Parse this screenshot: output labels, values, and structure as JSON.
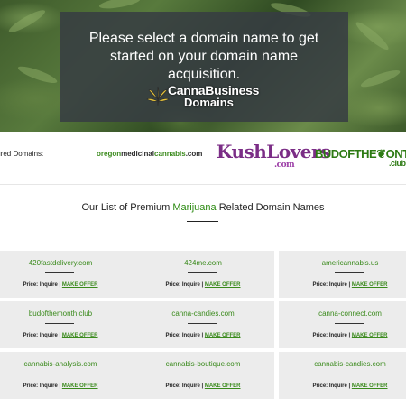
{
  "hero": {
    "heading": "Please select a domain name to get started on your domain name acquisition.",
    "logo": {
      "line1": "CannaBusiness",
      "line2": "Domains"
    }
  },
  "featured": {
    "label": "tured Domains:",
    "logos": [
      {
        "parts": [
          "oregon",
          "medicinal",
          "cannabis",
          ".com"
        ]
      },
      {
        "main": "KushLovers",
        "suffix": ".com"
      },
      {
        "main": "BUDOFTHE❦ONTH",
        "suffix": ".club"
      }
    ]
  },
  "list": {
    "heading_prefix": "Our List of Premium ",
    "heading_highlight": "Marijuana",
    "heading_suffix": " Related Domain Names"
  },
  "cards": [
    {
      "name": "420fastdelivery.com"
    },
    {
      "name": "424me.com"
    },
    {
      "name": "americannabis.us"
    },
    {
      "name": "budofthemonth.club"
    },
    {
      "name": "canna-candies.com"
    },
    {
      "name": "canna-connect.com"
    },
    {
      "name": "cannabis-analysis.com"
    },
    {
      "name": "cannabis-boutique.com"
    },
    {
      "name": "cannabis-candies.com"
    }
  ],
  "card_price_label": "Price: Inquire | ",
  "card_offer_label": "MAKE OFFER",
  "colors": {
    "accent_green": "#3a8a1c",
    "overlay": "#373c42",
    "card_bg": "#ececec",
    "kush_purple": "#7b2d86"
  }
}
